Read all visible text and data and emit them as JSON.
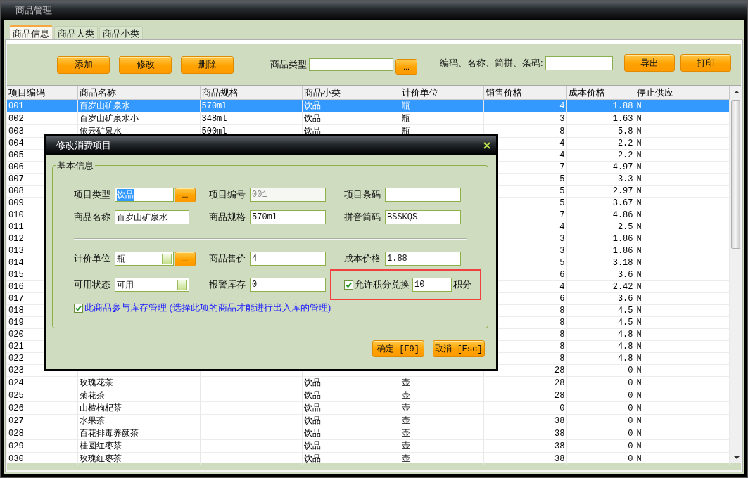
{
  "window": {
    "title": "商品管理"
  },
  "tabs": [
    {
      "label": "商品信息",
      "selected": true
    },
    {
      "label": "商品大类",
      "selected": false
    },
    {
      "label": "商品小类",
      "selected": false
    }
  ],
  "toolbar": {
    "buttons_left": [
      "添加",
      "修改",
      "删除"
    ],
    "type_label": "商品类型",
    "browse_button": "...",
    "search_label": "编码、名称、简拼、条码:",
    "buttons_right": [
      "导出",
      "打印"
    ]
  },
  "table": {
    "columns": [
      "项目编码",
      "商品名称",
      "商品规格",
      "商品小类",
      "计价单位",
      "销售价格",
      "成本价格",
      "停止供应"
    ],
    "rows": [
      {
        "selected": true,
        "cells": [
          "001",
          "百岁山矿泉水",
          "570ml",
          "饮品",
          "瓶",
          "4",
          "1.88",
          "N"
        ]
      },
      {
        "selected": false,
        "cells": [
          "002",
          "百岁山矿泉水小",
          "348ml",
          "饮品",
          "瓶",
          "3",
          "1.63",
          "N"
        ]
      },
      {
        "selected": false,
        "cells": [
          "003",
          "依云矿泉水",
          "500ml",
          "饮品",
          "瓶",
          "8",
          "5.8",
          "N"
        ]
      },
      {
        "selected": false,
        "cells": [
          "004",
          null,
          null,
          null,
          null,
          "4",
          "2.2",
          "N"
        ]
      },
      {
        "selected": false,
        "cells": [
          "005",
          null,
          null,
          null,
          null,
          "4",
          "2.2",
          "N"
        ]
      },
      {
        "selected": false,
        "cells": [
          "006",
          null,
          null,
          null,
          null,
          "7",
          "4.97",
          "N"
        ]
      },
      {
        "selected": false,
        "cells": [
          "007",
          null,
          null,
          null,
          null,
          "5",
          "3.3",
          "N"
        ]
      },
      {
        "selected": false,
        "cells": [
          "008",
          null,
          null,
          null,
          null,
          "5",
          "2.97",
          "N"
        ]
      },
      {
        "selected": false,
        "cells": [
          "009",
          null,
          null,
          null,
          null,
          "5",
          "3.67",
          "N"
        ]
      },
      {
        "selected": false,
        "cells": [
          "010",
          null,
          null,
          null,
          null,
          "7",
          "4.86",
          "N"
        ]
      },
      {
        "selected": false,
        "cells": [
          "011",
          null,
          null,
          null,
          null,
          "4",
          "2.5",
          "N"
        ]
      },
      {
        "selected": false,
        "cells": [
          "012",
          null,
          null,
          null,
          null,
          "3",
          "1.86",
          "N"
        ]
      },
      {
        "selected": false,
        "cells": [
          "013",
          null,
          null,
          null,
          null,
          "3",
          "1.86",
          "N"
        ]
      },
      {
        "selected": false,
        "cells": [
          "014",
          null,
          null,
          null,
          null,
          "5",
          "3.18",
          "N"
        ]
      },
      {
        "selected": false,
        "cells": [
          "015",
          null,
          null,
          null,
          null,
          "6",
          "3.6",
          "N"
        ]
      },
      {
        "selected": false,
        "cells": [
          "016",
          null,
          null,
          null,
          null,
          "4",
          "2.42",
          "N"
        ]
      },
      {
        "selected": false,
        "cells": [
          "017",
          null,
          null,
          null,
          null,
          "6",
          "3.6",
          "N"
        ]
      },
      {
        "selected": false,
        "cells": [
          "018",
          null,
          null,
          null,
          null,
          "8",
          "4.5",
          "N"
        ]
      },
      {
        "selected": false,
        "cells": [
          "019",
          null,
          null,
          null,
          null,
          "8",
          "4.5",
          "N"
        ]
      },
      {
        "selected": false,
        "cells": [
          "020",
          null,
          null,
          null,
          null,
          "8",
          "4.8",
          "N"
        ]
      },
      {
        "selected": false,
        "cells": [
          "021",
          null,
          null,
          null,
          null,
          "8",
          "4.8",
          "N"
        ]
      },
      {
        "selected": false,
        "cells": [
          "022",
          null,
          null,
          null,
          null,
          "8",
          "4.8",
          "N"
        ]
      },
      {
        "selected": false,
        "cells": [
          "023",
          null,
          null,
          null,
          null,
          "28",
          "0",
          "N"
        ]
      },
      {
        "selected": false,
        "cells": [
          "024",
          "玫瑰花茶",
          null,
          "饮品",
          "壶",
          "28",
          "0",
          "N"
        ]
      },
      {
        "selected": false,
        "cells": [
          "025",
          "菊花茶",
          null,
          "饮品",
          "壶",
          "28",
          "0",
          "N"
        ]
      },
      {
        "selected": false,
        "cells": [
          "026",
          "山楂枸杞茶",
          null,
          "饮品",
          "壶",
          "0",
          "0",
          "N"
        ]
      },
      {
        "selected": false,
        "cells": [
          "027",
          "水果茶",
          null,
          "饮品",
          "壶",
          "38",
          "0",
          "N"
        ]
      },
      {
        "selected": false,
        "cells": [
          "028",
          "百花排毒养颜茶",
          null,
          "饮品",
          "壶",
          "38",
          "0",
          "N"
        ]
      },
      {
        "selected": false,
        "cells": [
          "029",
          "桂圆红枣茶",
          null,
          "饮品",
          "壶",
          "38",
          "0",
          "N"
        ]
      },
      {
        "selected": false,
        "cells": [
          "030",
          "玫瑰红枣茶",
          null,
          "饮品",
          "壶",
          "38",
          "0",
          "N"
        ]
      }
    ]
  },
  "dialog": {
    "title": "修改消费项目",
    "group_title": "基本信息",
    "rows": [
      [
        {
          "kind": "picker",
          "label": "项目类型",
          "value": "饮品",
          "text_selected": true,
          "button": "...",
          "disabled": false
        },
        {
          "kind": "text",
          "label": "项目编号",
          "value": "001",
          "disabled": true
        },
        {
          "kind": "text",
          "label": "项目条码",
          "disabled": false
        }
      ],
      [
        {
          "kind": "text",
          "label": "商品名称",
          "value": "百岁山矿泉水",
          "disabled": false
        },
        {
          "kind": "text",
          "label": "商品规格",
          "value": "570ml",
          "disabled": false
        },
        {
          "kind": "text",
          "label": "拼音简码",
          "value": "BSSKQS",
          "disabled": false
        }
      ],
      [
        {
          "kind": "combo_picker",
          "label": "计价单位",
          "value": "瓶",
          "button": "...",
          "disabled": false
        },
        {
          "kind": "text",
          "label": "商品售价",
          "value": "4",
          "disabled": false
        },
        {
          "kind": "text",
          "label": "成本价格",
          "value": "1.88",
          "disabled": false
        }
      ],
      [
        {
          "kind": "combo",
          "label": "可用状态",
          "value": "可用",
          "disabled": false
        },
        {
          "kind": "text",
          "label": "报警库存",
          "value": "0",
          "disabled": false
        }
      ]
    ],
    "points": {
      "label": "允许积分兑换",
      "checked": true,
      "value": "10",
      "unit": "积分",
      "highlighted": true
    },
    "stock_option": {
      "label": "此商品参与库存管理 (选择此项的商品才能进行出入库的管理)",
      "checked": true
    },
    "buttons": [
      "确定 [F9]",
      "取消 [Esc]"
    ]
  }
}
